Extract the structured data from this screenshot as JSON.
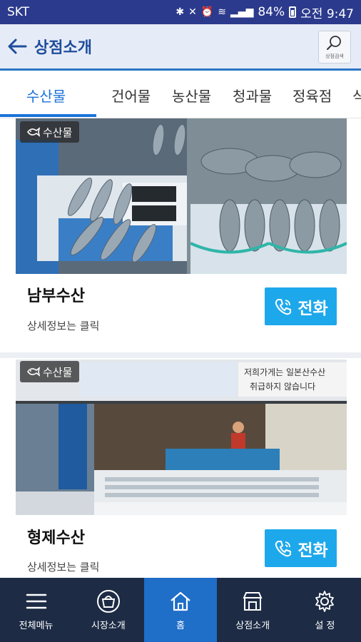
{
  "status_bar": {
    "carrier": "SKT",
    "battery": "84%",
    "time": "오전 9:47"
  },
  "app_bar": {
    "title": "상점소개",
    "search_label": "상점검색"
  },
  "tabs": [
    {
      "label": "수산물",
      "active": true
    },
    {
      "label": "건어물",
      "active": false
    },
    {
      "label": "농산물",
      "active": false
    },
    {
      "label": "청과물",
      "active": false
    },
    {
      "label": "정육점",
      "active": false
    },
    {
      "label": "식",
      "active": false
    }
  ],
  "shops": [
    {
      "category": "수산물",
      "name": "남부수산",
      "description": "상세정보는 클릭",
      "call_label": "전화"
    },
    {
      "category": "수산물",
      "name": "형제수산",
      "description": "상세정보는 클릭",
      "call_label": "전화",
      "sign_text": "저희가게는 일본산수산물 취급하지 않습니다"
    }
  ],
  "bottom_nav": [
    {
      "label": "전체메뉴",
      "icon": "menu-icon",
      "active": false
    },
    {
      "label": "시장소개",
      "icon": "market-basket-icon",
      "active": false
    },
    {
      "label": "홈",
      "icon": "home-icon",
      "active": true
    },
    {
      "label": "상점소개",
      "icon": "store-icon",
      "active": false
    },
    {
      "label": "설 정",
      "icon": "gear-icon",
      "active": false
    }
  ],
  "colors": {
    "status_bar": "#2b3a8c",
    "accent": "#1a73d9",
    "call_button": "#1ea8ec",
    "bottom_nav": "#1d2b45",
    "bottom_nav_active": "#1f6ec8"
  }
}
